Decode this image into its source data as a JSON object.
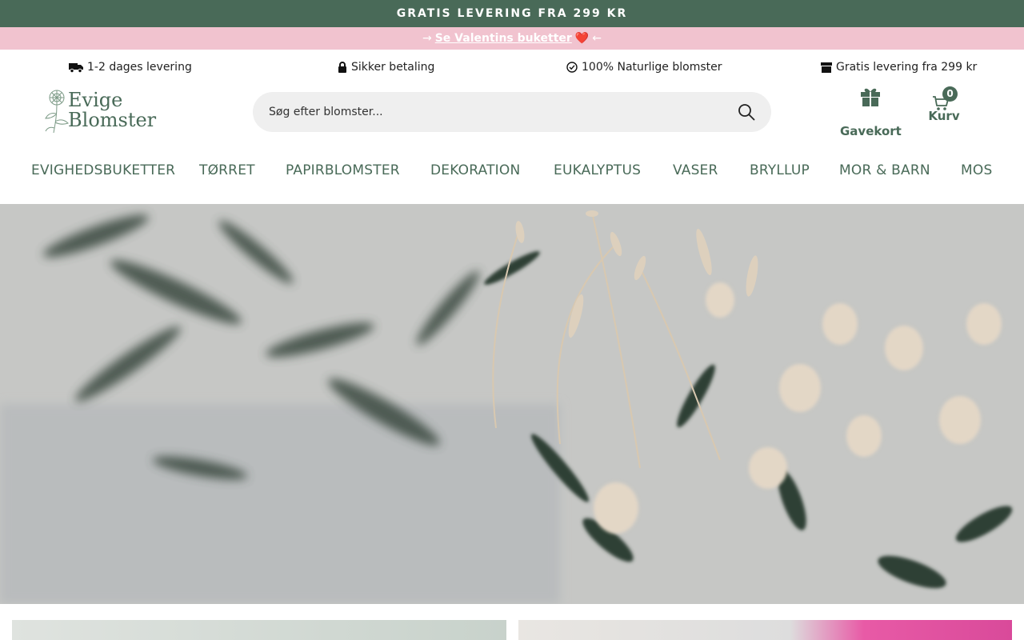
{
  "topbar": {
    "text": "GRATIS LEVERING FRA 299 KR"
  },
  "promo": {
    "arrow_left": "→",
    "link": "Se Valentins buketter",
    "heart": "❤️",
    "arrow_right": "←"
  },
  "usp": [
    {
      "icon": "truck-icon",
      "text": "1-2 dages levering"
    },
    {
      "icon": "lock-icon",
      "text": "Sikker betaling"
    },
    {
      "icon": "check-circle-icon",
      "text": "100% Naturlige blomster"
    },
    {
      "icon": "box-icon",
      "text": "Gratis levering fra 299 kr"
    }
  ],
  "logo": {
    "line1": "Evige",
    "line2": "Blomster"
  },
  "search": {
    "placeholder": "Søg efter blomster..."
  },
  "gift": {
    "label": "Gavekort"
  },
  "cart": {
    "label": "Kurv",
    "count": "0"
  },
  "nav": [
    "EVIGHEDSBUKETTER",
    "TØRRET",
    "PAPIRBLOMSTER",
    "DEKORATION",
    "EUKALYPTUS",
    "VASER",
    "BRYLLUP",
    "MOR & BARN",
    "MOS"
  ],
  "colors": {
    "brand": "#496a58",
    "promo": "#f1c3cf",
    "heart": "#e2293a"
  }
}
